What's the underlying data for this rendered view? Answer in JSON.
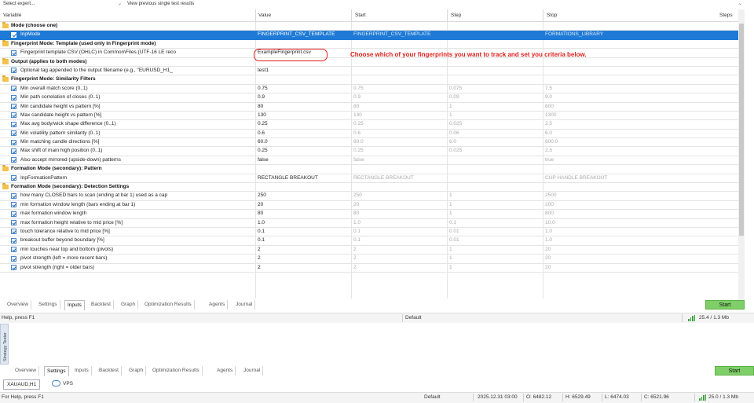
{
  "top": {
    "expert_select": "Select expert...",
    "results_select": "View previous single test results"
  },
  "columns": {
    "variable": "Variable",
    "value": "Value",
    "start": "Start",
    "step": "Step",
    "stop": "Stop",
    "steps": "Steps"
  },
  "rows": [
    {
      "type": "group",
      "name": "Mode (choose one)"
    },
    {
      "type": "param",
      "selected": true,
      "name": "InpMode",
      "value": "FINGERPRINT_CSV_TEMPLATE",
      "start": "FINGERPRINT_CSV_TEMPLATE",
      "step": "",
      "stop": "FORMATIONS_LIBRARY"
    },
    {
      "type": "group",
      "name": "Fingerprint Mode: Template (used only in Fingerprint mode)"
    },
    {
      "type": "param",
      "name": "Fingerprint template CSV (OHLC) in Common\\Files (UTF-16 LE reco",
      "value": "ExampleFingerprint.csv",
      "start": "",
      "step": "",
      "stop": ""
    },
    {
      "type": "group",
      "name": "Output (applies to both modes)"
    },
    {
      "type": "param",
      "name": "Optional tag appended to the output filename (e.g., \"EURUSD_H1_",
      "value": "test1",
      "start": "",
      "step": "",
      "stop": ""
    },
    {
      "type": "group",
      "name": "Fingerprint Mode: Similarity Filters"
    },
    {
      "type": "param",
      "name": "Min overall match score  (0..1)",
      "value": "0.75",
      "start": "0.75",
      "step": "0.075",
      "stop": "7.5"
    },
    {
      "type": "param",
      "name": "Min path correlation of closes (0..1)",
      "value": "0.9",
      "start": "0.9",
      "step": "0.09",
      "stop": "9.0"
    },
    {
      "type": "param",
      "name": "Min candidate height vs pattern [%]",
      "value": "80",
      "start": "80",
      "step": "1",
      "stop": "800"
    },
    {
      "type": "param",
      "name": "Max candidate height vs pattern [%]",
      "value": "130",
      "start": "130",
      "step": "1",
      "stop": "1300"
    },
    {
      "type": "param",
      "name": "Max avg body/wick shape difference (0..1)",
      "value": "0.25",
      "start": "0.25",
      "step": "0.025",
      "stop": "2.5"
    },
    {
      "type": "param",
      "name": "Min volatility pattern similarity (0..1)",
      "value": "0.6",
      "start": "0.6",
      "step": "0.06",
      "stop": "6.0"
    },
    {
      "type": "param",
      "name": "Min matching candle directions [%]",
      "value": "60.0",
      "start": "60.0",
      "step": "6.0",
      "stop": "600.0"
    },
    {
      "type": "param",
      "name": "Max shift of main high position (0..1)",
      "value": "0.25",
      "start": "0.25",
      "step": "0.025",
      "stop": "2.5"
    },
    {
      "type": "param",
      "name": "Also accept mirrored (upside-down) patterns",
      "value": "false",
      "start": "false",
      "step": "",
      "stop": "true"
    },
    {
      "type": "group",
      "name": "Formation Mode (secondary): Pattern"
    },
    {
      "type": "param",
      "name": "InpFormationPattern",
      "value": "RECTANGLE BREAKOUT",
      "start": "RECTANGLE BREAKOUT",
      "step": "",
      "stop": "CUP HANDLE BREAKOUT"
    },
    {
      "type": "group",
      "name": "Formation Mode (secondary): Detection Settings"
    },
    {
      "type": "param",
      "name": "how many CLOSED bars to scan (ending at bar 1)  used as a cap",
      "value": "250",
      "start": "250",
      "step": "1",
      "stop": "2500"
    },
    {
      "type": "param",
      "name": "min formation window length (bars ending at bar 1)",
      "value": "20",
      "start": "20",
      "step": "1",
      "stop": "200"
    },
    {
      "type": "param",
      "name": "max formation window length",
      "value": "80",
      "start": "80",
      "step": "1",
      "stop": "800"
    },
    {
      "type": "param",
      "name": "max formation height relative to mid price [%]",
      "value": "1.0",
      "start": "1.0",
      "step": "0.1",
      "stop": "10.0"
    },
    {
      "type": "param",
      "name": "touch tolerance relative to mid price [%]",
      "value": "0.1",
      "start": "0.1",
      "step": "0.01",
      "stop": "1.0"
    },
    {
      "type": "param",
      "name": "breakout buffer beyond boundary [%]",
      "value": "0.1",
      "start": "0.1",
      "step": "0.01",
      "stop": "1.0"
    },
    {
      "type": "param",
      "name": "min touches near top and bottom (pivots)",
      "value": "2",
      "start": "2",
      "step": "1",
      "stop": "20"
    },
    {
      "type": "param",
      "name": "pivot strength (left = more recent bars)",
      "value": "2",
      "start": "2",
      "step": "1",
      "stop": "20"
    },
    {
      "type": "param",
      "name": "pivot strength (right = older bars)",
      "value": "2",
      "start": "2",
      "step": "1",
      "stop": "20"
    }
  ],
  "annotation": "Choose which of your fingerprints you want to track and set you criteria below.",
  "tabs_inner": [
    "Overview",
    "Settings",
    "Inputs",
    "Backtest",
    "Graph",
    "Optimization Results",
    "Agents",
    "Journal"
  ],
  "tabs_inner_active": "Inputs",
  "start_label": "Start",
  "status_inner": {
    "help": "Help, press F1",
    "profile": "Default",
    "memory": "25.4 / 1.3 Mb"
  },
  "side_label": "Strategy Tester",
  "tabs_outer": [
    "Overview",
    "Settings",
    "Inputs",
    "Backtest",
    "Graph",
    "Optimization Results",
    "Agents",
    "Journal"
  ],
  "tabs_outer_active": "Settings",
  "symbol_tab": "XAUAUD,H1",
  "vps_tab": "VPS",
  "status_outer": {
    "help": "For Help, press F1",
    "profile": "Default",
    "datetime": "2025.12.31 03:00",
    "open": "O: 6482.12",
    "high": "H: 6529.49",
    "low": "L: 6474.03",
    "close": "C: 6521.96",
    "memory": "25.0 / 1.3 Mb"
  },
  "colors": {
    "selection": "#1e7ad6",
    "annotation": "#e0201c",
    "start_button": "#7fcf68"
  }
}
